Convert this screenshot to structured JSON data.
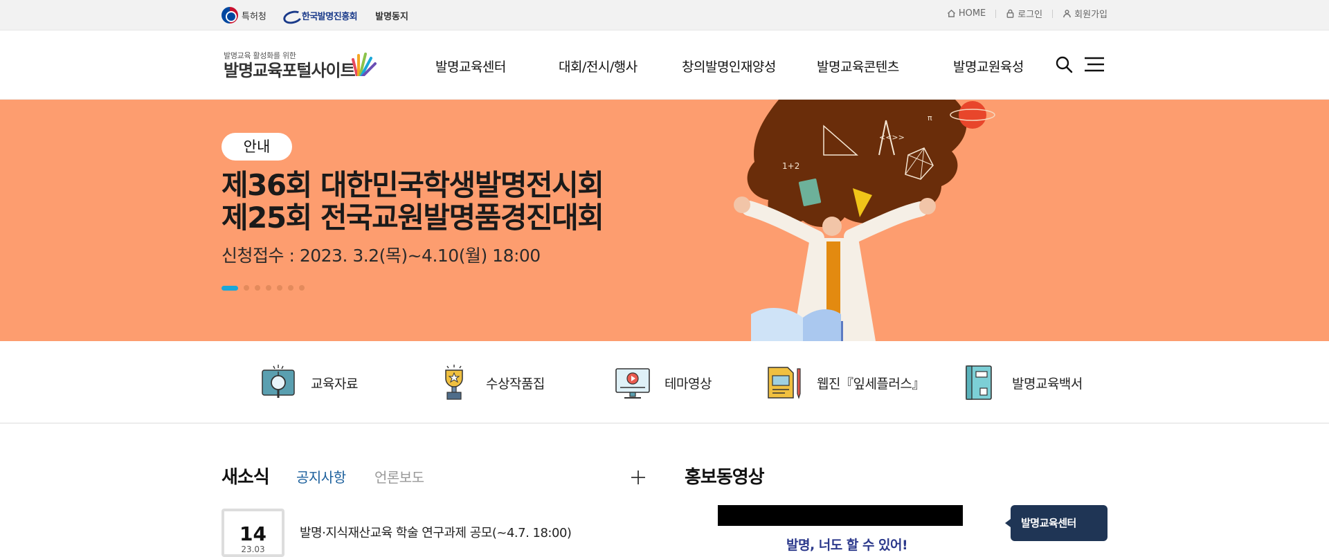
{
  "topbar": {
    "gov_label": "특허청",
    "kipa_label": "한국발명진흥회",
    "balmyung_label": "발명동지",
    "util": {
      "home": "HOME",
      "login": "로그인",
      "join": "회원가입"
    }
  },
  "header": {
    "logo_tag": "발명교육 활성화를 위한",
    "logo_name": "발명교육포털사이트",
    "nav": [
      "발명교육센터",
      "대회/전시/행사",
      "창의발명인재양성",
      "발명교육콘텐츠",
      "발명교원육성"
    ]
  },
  "hero": {
    "badge": "안내",
    "title_line1": "제36회 대한민국학생발명전시회",
    "title_line2": "제25회 전국교원발명품경진대회",
    "subtitle": "신청접수 : 2023. 3.2(목)~4.10(월) 18:00",
    "slide_count": 7,
    "active_slide": 1,
    "bg_color": "#fd9d6f"
  },
  "quick_links": [
    {
      "label": "교육자료",
      "icon": "book-magnifier-icon"
    },
    {
      "label": "수상작품집",
      "icon": "trophy-icon"
    },
    {
      "label": "테마영상",
      "icon": "video-monitor-icon"
    },
    {
      "label": "웹진『잎세플러스』",
      "icon": "webzine-icon"
    },
    {
      "label": "발명교육백서",
      "icon": "whitepaper-book-icon"
    }
  ],
  "news": {
    "title": "새소식",
    "tabs": [
      "공지사항",
      "언론보도"
    ],
    "items": [
      {
        "day": "14",
        "month": "23.03",
        "text": "발명·지식재산교육 학술 연구과제 공모(~4.7. 18:00)"
      }
    ]
  },
  "promo": {
    "title": "홍보동영상",
    "video_caption": "발명, 너도 할 수 있어!",
    "chip_label": "발명교육센터"
  }
}
